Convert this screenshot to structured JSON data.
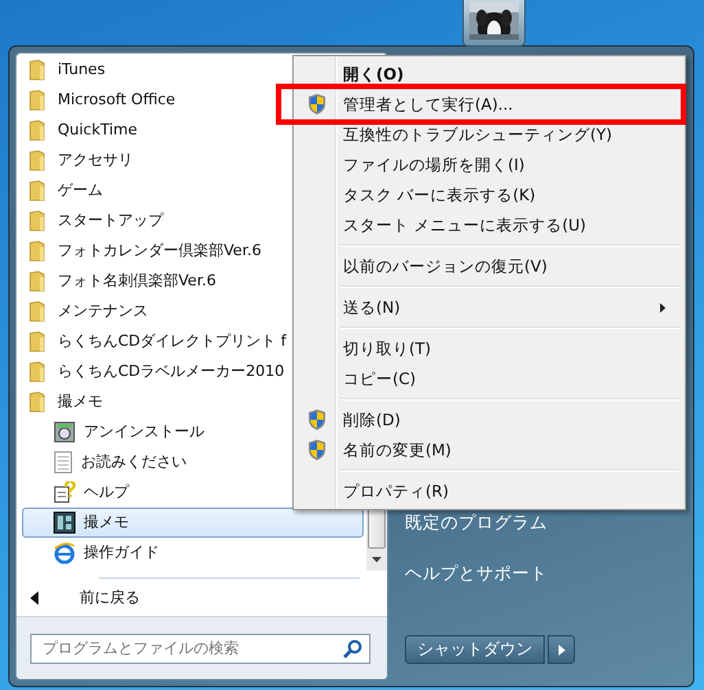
{
  "programs": [
    {
      "label": "iTunes",
      "kind": "folder",
      "selected": false
    },
    {
      "label": "Microsoft Office",
      "kind": "folder",
      "selected": false
    },
    {
      "label": "QuickTime",
      "kind": "folder",
      "selected": false
    },
    {
      "label": "アクセサリ",
      "kind": "folder",
      "selected": false
    },
    {
      "label": "ゲーム",
      "kind": "folder",
      "selected": false
    },
    {
      "label": "スタートアップ",
      "kind": "folder",
      "selected": false
    },
    {
      "label": "フォトカレンダー倶楽部Ver.6",
      "kind": "folder",
      "selected": false
    },
    {
      "label": "フォト名刺倶楽部Ver.6",
      "kind": "folder",
      "selected": false
    },
    {
      "label": "メンテナンス",
      "kind": "folder",
      "selected": false
    },
    {
      "label": "らくちんCDダイレクトプリント f",
      "kind": "folder",
      "selected": false
    },
    {
      "label": "らくちんCDラベルメーカー2010",
      "kind": "folder",
      "selected": false
    },
    {
      "label": "撮メモ",
      "kind": "folder",
      "selected": false,
      "children": [
        {
          "label": "アンインストール",
          "kind": "uninstall",
          "selected": false
        },
        {
          "label": "お読みください",
          "kind": "document",
          "selected": false
        },
        {
          "label": "ヘルプ",
          "kind": "help",
          "selected": false
        },
        {
          "label": "撮メモ",
          "kind": "app",
          "selected": true
        },
        {
          "label": "操作ガイド",
          "kind": "web",
          "selected": false
        }
      ]
    }
  ],
  "back": {
    "label": "前に戻る"
  },
  "search": {
    "placeholder": "プログラムとファイルの検索"
  },
  "right_pane": {
    "items": [
      "既定のプログラム",
      "ヘルプとサポート"
    ],
    "shutdown": "シャットダウン"
  },
  "context_menu": {
    "groups": [
      [
        {
          "label": "開く(O)",
          "default": true,
          "elevated": false,
          "submenu": false,
          "highlighted": false
        },
        {
          "label": "管理者として実行(A)...",
          "default": false,
          "elevated": true,
          "submenu": false,
          "highlighted": true
        },
        {
          "label": "互換性のトラブルシューティング(Y)",
          "default": false,
          "elevated": false,
          "submenu": false,
          "highlighted": false
        },
        {
          "label": "ファイルの場所を開く(I)",
          "default": false,
          "elevated": false,
          "submenu": false,
          "highlighted": false
        },
        {
          "label": "タスク バーに表示する(K)",
          "default": false,
          "elevated": false,
          "submenu": false,
          "highlighted": false
        },
        {
          "label": "スタート メニューに表示する(U)",
          "default": false,
          "elevated": false,
          "submenu": false,
          "highlighted": false
        }
      ],
      [
        {
          "label": "以前のバージョンの復元(V)",
          "default": false,
          "elevated": false,
          "submenu": false,
          "highlighted": false
        }
      ],
      [
        {
          "label": "送る(N)",
          "default": false,
          "elevated": false,
          "submenu": true,
          "highlighted": false
        }
      ],
      [
        {
          "label": "切り取り(T)",
          "default": false,
          "elevated": false,
          "submenu": false,
          "highlighted": false
        },
        {
          "label": "コピー(C)",
          "default": false,
          "elevated": false,
          "submenu": false,
          "highlighted": false
        }
      ],
      [
        {
          "label": "削除(D)",
          "default": false,
          "elevated": true,
          "submenu": false,
          "highlighted": false
        },
        {
          "label": "名前の変更(M)",
          "default": false,
          "elevated": true,
          "submenu": false,
          "highlighted": false
        }
      ],
      [
        {
          "label": "プロパティ(R)",
          "default": false,
          "elevated": false,
          "submenu": false,
          "highlighted": false
        }
      ]
    ]
  }
}
